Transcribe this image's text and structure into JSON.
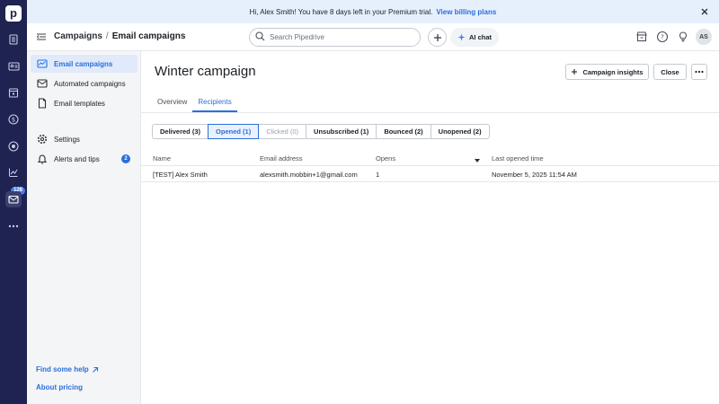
{
  "banner": {
    "text": "Hi, Alex Smith! You have 8 days left in your Premium trial.",
    "link": "View billing plans"
  },
  "rail": {
    "logo_letter": "p",
    "mail_badge": "128"
  },
  "header": {
    "breadcrumb_parent": "Campaigns",
    "breadcrumb_separator": "/",
    "breadcrumb_current": "Email campaigns",
    "search_placeholder": "Search Pipedrive",
    "ai_chat": "AI chat",
    "avatar_initials": "AS"
  },
  "sidebar": {
    "items": [
      {
        "label": "Email campaigns",
        "icon": "email-campaign-icon"
      },
      {
        "label": "Automated campaigns",
        "icon": "automation-icon"
      },
      {
        "label": "Email templates",
        "icon": "template-icon"
      },
      {
        "label": "Settings",
        "icon": "gear-icon"
      },
      {
        "label": "Alerts and tips",
        "icon": "bell-icon",
        "count": "2"
      }
    ],
    "help_link": "Find some help",
    "pricing_link": "About pricing"
  },
  "main": {
    "title": "Winter campaign",
    "campaign_insights": "Campaign insights",
    "close": "Close",
    "tabs": [
      "Overview",
      "Recipients"
    ],
    "filters": [
      "Delivered (3)",
      "Opened (1)",
      "Clicked (0)",
      "Unsubscribed (1)",
      "Bounced (2)",
      "Unopened (2)"
    ],
    "columns": [
      "Name",
      "Email address",
      "Opens",
      "Last opened time"
    ],
    "rows": [
      [
        "[TEST] Alex Smith",
        "alexsmith.mobbin+1@gmail.com",
        "1",
        "November 5, 2025 11:54 AM"
      ]
    ]
  },
  "colors": {
    "rail": "#1f2351",
    "accent": "#2a6fdb",
    "banner_bg": "#e6f0fd",
    "sidebar_bg": "#f4f5f7"
  }
}
